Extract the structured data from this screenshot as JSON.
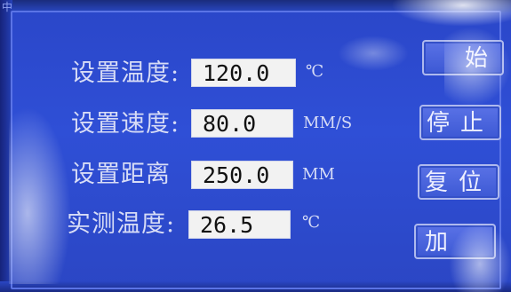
{
  "top_strip_text": "中",
  "rows": [
    {
      "label": "设置温度:",
      "value": "120.0",
      "unit": "℃"
    },
    {
      "label": "设置速度:",
      "value": "80.0",
      "unit": "MM/S"
    },
    {
      "label": "设置距离",
      "value": "250.0",
      "unit": "MM"
    },
    {
      "label": "实测温度:",
      "value": "26.5",
      "unit": "℃"
    }
  ],
  "buttons": {
    "start": "始",
    "stop": "停止",
    "reset": "复位",
    "heat": "加"
  },
  "colors": {
    "background": "#2f4fd6",
    "field_bg": "#f2f2f2",
    "button_bg": "#4a64dc",
    "text": "#d7dcf6"
  }
}
